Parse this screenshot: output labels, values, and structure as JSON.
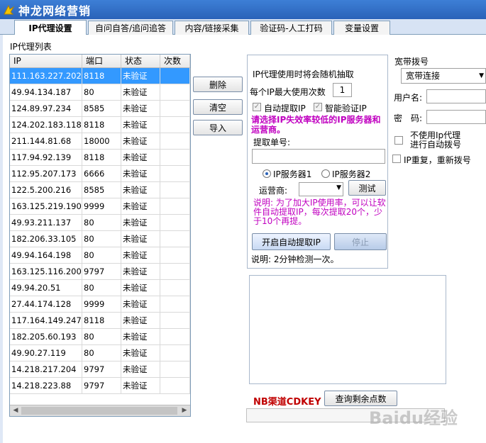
{
  "window": {
    "title": "神龙网络营销"
  },
  "tabs": [
    {
      "label": "IP代理设置"
    },
    {
      "label": "自问自答/追问追答"
    },
    {
      "label": "内容/链接采集"
    },
    {
      "label": "验证码-人工打码"
    },
    {
      "label": "变量设置"
    }
  ],
  "ip_list": {
    "title": "IP代理列表",
    "columns": [
      "IP",
      "端口",
      "状态",
      "次数"
    ],
    "rows": [
      {
        "ip": "111.163.227.202",
        "port": "8118",
        "status": "未验证",
        "count": ""
      },
      {
        "ip": "49.94.134.187",
        "port": "80",
        "status": "未验证",
        "count": ""
      },
      {
        "ip": "124.89.97.234",
        "port": "8585",
        "status": "未验证",
        "count": ""
      },
      {
        "ip": "124.202.183.118",
        "port": "8118",
        "status": "未验证",
        "count": ""
      },
      {
        "ip": "211.144.81.68",
        "port": "18000",
        "status": "未验证",
        "count": ""
      },
      {
        "ip": "117.94.92.139",
        "port": "8118",
        "status": "未验证",
        "count": ""
      },
      {
        "ip": "112.95.207.173",
        "port": "6666",
        "status": "未验证",
        "count": ""
      },
      {
        "ip": "122.5.200.216",
        "port": "8585",
        "status": "未验证",
        "count": ""
      },
      {
        "ip": "163.125.219.190",
        "port": "9999",
        "status": "未验证",
        "count": ""
      },
      {
        "ip": "49.93.211.137",
        "port": "80",
        "status": "未验证",
        "count": ""
      },
      {
        "ip": "182.206.33.105",
        "port": "80",
        "status": "未验证",
        "count": ""
      },
      {
        "ip": "49.94.164.198",
        "port": "80",
        "status": "未验证",
        "count": ""
      },
      {
        "ip": "163.125.116.200",
        "port": "9797",
        "status": "未验证",
        "count": ""
      },
      {
        "ip": "49.94.20.51",
        "port": "80",
        "status": "未验证",
        "count": ""
      },
      {
        "ip": "27.44.174.128",
        "port": "9999",
        "status": "未验证",
        "count": ""
      },
      {
        "ip": "117.164.149.247",
        "port": "8118",
        "status": "未验证",
        "count": ""
      },
      {
        "ip": "182.205.60.193",
        "port": "80",
        "status": "未验证",
        "count": ""
      },
      {
        "ip": "49.90.27.119",
        "port": "80",
        "status": "未验证",
        "count": ""
      },
      {
        "ip": "14.218.217.204",
        "port": "9797",
        "status": "未验证",
        "count": ""
      },
      {
        "ip": "14.218.223.88",
        "port": "9797",
        "status": "未验证",
        "count": ""
      }
    ],
    "selected_index": 0
  },
  "list_buttons": {
    "delete": "删除",
    "clear": "清空",
    "import": "导入"
  },
  "proxy_settings": {
    "heading": "IP代理使用时将会随机抽取",
    "max_use_label": "每个IP最大使用次数",
    "max_use_value": "1",
    "auto_fetch_label": "自动提取IP",
    "smart_verify_label": "智能验证IP",
    "warning": "请选择IP失效率较低的IP服务器和运营商。",
    "order_label": "提取单号:",
    "order_value": "",
    "server1": "IP服务器1",
    "server2": "IP服务器2",
    "carrier_label": "运营商:",
    "carrier_value": "",
    "test_button": "测试",
    "note": "说明: 为了加大IP使用率，可以让软件自动提取IP，每次提取20个，少于10个再提。",
    "start_button": "开启自动提取IP",
    "stop_button": "停止",
    "check_note": "说明: 2分钟检测一次。"
  },
  "dialup": {
    "section_label": "宽带拨号",
    "connection_value": "宽带连接",
    "username_label": "用户名:",
    "password_label": "密　码:",
    "no_proxy_line1": "不使用Ip代理",
    "no_proxy_line2": "进行自动拨号",
    "ip_repeat_label": "IP重复，重新拨号"
  },
  "cdkey": {
    "label": "NB渠道CDKEY",
    "query_button": "查询剩余点数",
    "value": ""
  },
  "watermark": "Baidu经验",
  "colors": {
    "title_bar": "#2a62b8",
    "selection": "#3399ff",
    "warning": "#c000c0",
    "cdkey": "#c00000"
  }
}
